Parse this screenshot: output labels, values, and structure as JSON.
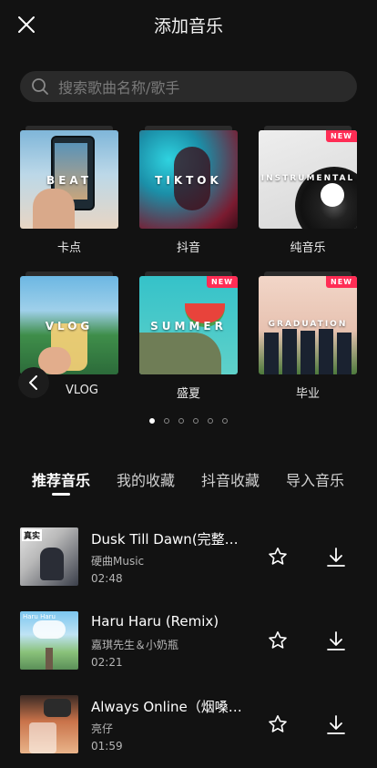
{
  "header": {
    "title": "添加音乐",
    "close_icon": "close-icon"
  },
  "search": {
    "placeholder": "搜索歌曲名称/歌手",
    "icon": "search-icon"
  },
  "categories": [
    {
      "label": "卡点",
      "overlay": "BEAT",
      "is_new": false
    },
    {
      "label": "抖音",
      "overlay": "TIKTOK",
      "is_new": false
    },
    {
      "label": "纯音乐",
      "overlay": "INSTRUMENTAL",
      "is_new": true,
      "badge": "NEW"
    },
    {
      "label": "VLOG",
      "overlay": "VLOG",
      "is_new": false
    },
    {
      "label": "盛夏",
      "overlay": "SUMMER",
      "is_new": true,
      "badge": "NEW"
    },
    {
      "label": "毕业",
      "overlay": "GRADUATION",
      "is_new": true,
      "badge": "NEW"
    }
  ],
  "pagination": {
    "current_page": 1,
    "total_pages": 6
  },
  "tabs": [
    {
      "label": "推荐音乐",
      "active": true
    },
    {
      "label": "我的收藏",
      "active": false
    },
    {
      "label": "抖音收藏",
      "active": false
    },
    {
      "label": "导入音乐",
      "active": false
    }
  ],
  "tracks": [
    {
      "title": "Dusk Till Dawn(完整…",
      "artist": "硬曲Music",
      "duration": "02:48",
      "cover_text": "真实"
    },
    {
      "title": "Haru Haru (Remix)",
      "artist": "嘉琪先生＆小奶瓶",
      "duration": "02:21",
      "cover_text": "Haru Haru"
    },
    {
      "title": "Always Online（烟嗓…",
      "artist": "亮仔",
      "duration": "01:59",
      "cover_text": ""
    }
  ],
  "colors": {
    "background": "#121212",
    "search_bg": "#2a2a2a",
    "badge": "#ff2d55",
    "text_secondary": "#b5b5b5"
  }
}
